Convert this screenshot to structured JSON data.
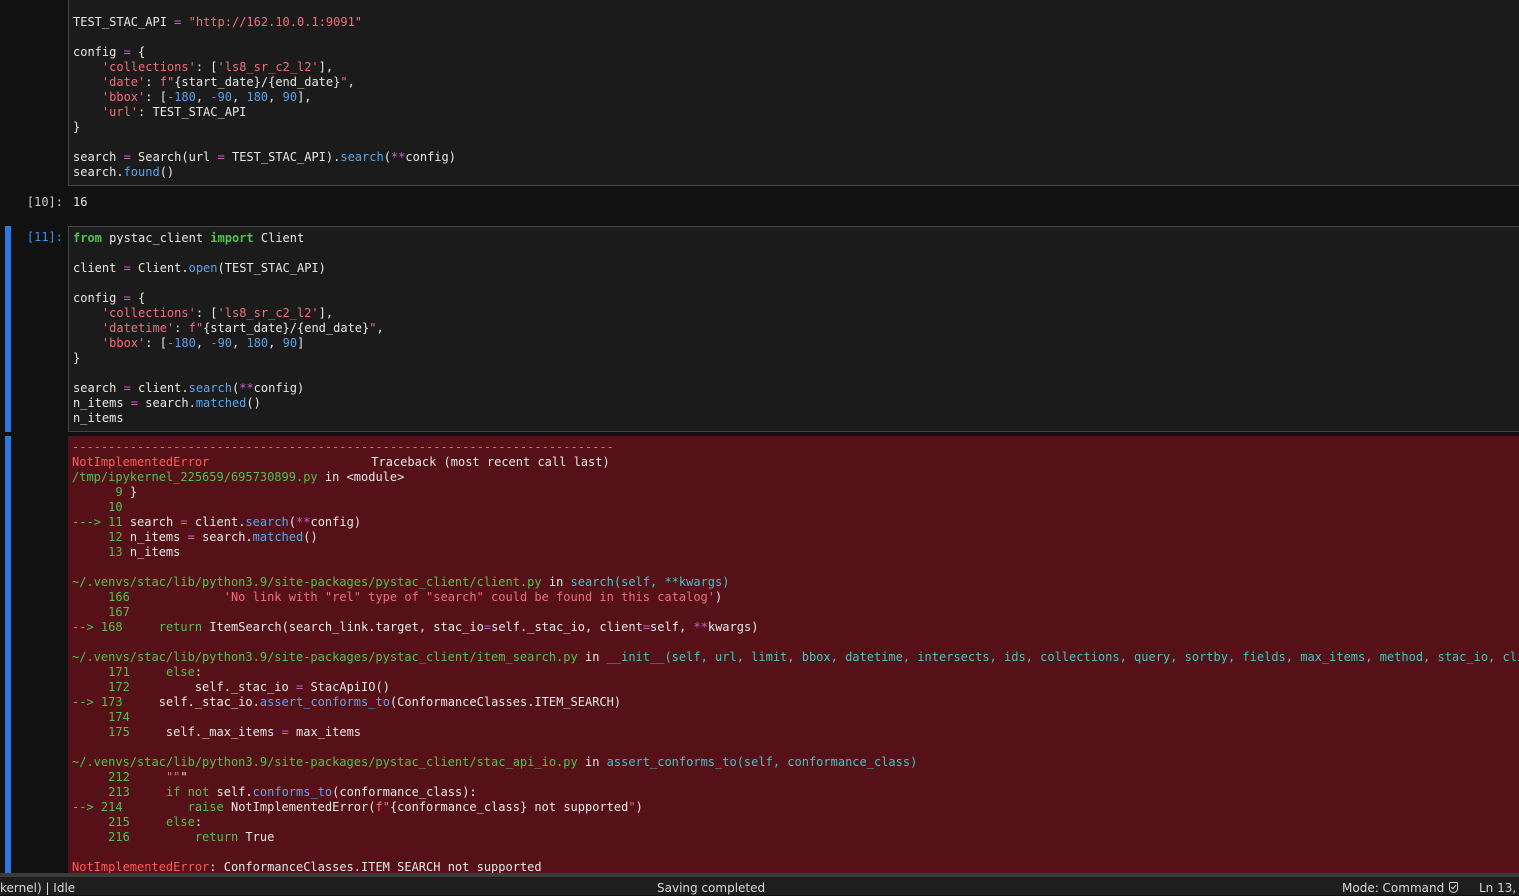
{
  "cells": {
    "cell10": {
      "code": [
        "TEST_STAC_API = \"http://162.10.0.1:9091\"",
        "",
        "config = {",
        "    'collections': ['ls8_sr_c2_l2'],",
        "    'date': f\"{start_date}/{end_date}\",",
        "    'bbox': [-180, -90, 180, 90],",
        "    'url': TEST_STAC_API",
        "}",
        "",
        "search = Search(url = TEST_STAC_API).search(**config)",
        "search.found()"
      ],
      "out_prompt": "[10]:",
      "output": "16"
    },
    "cell11": {
      "in_prompt": "[11]:",
      "code": [
        "from pystac_client import Client",
        "",
        "client = Client.open(TEST_STAC_API)",
        "",
        "config = {",
        "    'collections': ['ls8_sr_c2_l2'],",
        "    'datetime': f\"{start_date}/{end_date}\",",
        "    'bbox': [-180, -90, 180, 90]",
        "}",
        "",
        "search = client.search(**config)",
        "n_items = search.matched()",
        "n_items"
      ],
      "traceback": {
        "separator": "---------------------------------------------------------------------------",
        "error_name": "NotImplementedError",
        "header_right": "Traceback (most recent call last)",
        "frames": [
          {
            "file": "/tmp/ipykernel_225659/695730899.py",
            "in_word": "in",
            "location": "<module>",
            "lines": [
              {
                "arrow": "",
                "num": "9",
                "code": "}"
              },
              {
                "arrow": "",
                "num": "10",
                "code": ""
              },
              {
                "arrow": "--->",
                "num": "11",
                "code": "search = client.search(**config)"
              },
              {
                "arrow": "",
                "num": "12",
                "code": "n_items = search.matched()"
              },
              {
                "arrow": "",
                "num": "13",
                "code": "n_items"
              }
            ]
          },
          {
            "file": "~/.venvs/stac/lib/python3.9/site-packages/pystac_client/client.py",
            "in_word": "in",
            "location": "search(self, **kwargs)",
            "lines": [
              {
                "arrow": "",
                "num": "166",
                "code": "            'No link with \"rel\" type of \"search\" could be found in this catalog')"
              },
              {
                "arrow": "",
                "num": "167",
                "code": ""
              },
              {
                "arrow": "-->",
                "num": "168",
                "code": "    return ItemSearch(search_link.target, stac_io=self._stac_io, client=self, **kwargs)"
              }
            ]
          },
          {
            "file": "~/.venvs/stac/lib/python3.9/site-packages/pystac_client/item_search.py",
            "in_word": "in",
            "location": "__init__(self, url, limit, bbox, datetime, intersects, ids, collections, query, sortby, fields, max_items, method, stac_io, client)",
            "lines": [
              {
                "arrow": "",
                "num": "171",
                "code": "    else:"
              },
              {
                "arrow": "",
                "num": "172",
                "code": "        self._stac_io = StacApiIO()"
              },
              {
                "arrow": "-->",
                "num": "173",
                "code": "    self._stac_io.assert_conforms_to(ConformanceClasses.ITEM_SEARCH)"
              },
              {
                "arrow": "",
                "num": "174",
                "code": ""
              },
              {
                "arrow": "",
                "num": "175",
                "code": "    self._max_items = max_items"
              }
            ]
          },
          {
            "file": "~/.venvs/stac/lib/python3.9/site-packages/pystac_client/stac_api_io.py",
            "in_word": "in",
            "location": "assert_conforms_to(self, conformance_class)",
            "lines": [
              {
                "arrow": "",
                "num": "212",
                "code": "    \"\"\""
              },
              {
                "arrow": "",
                "num": "213",
                "code": "    if not self.conforms_to(conformance_class):"
              },
              {
                "arrow": "-->",
                "num": "214",
                "code": "        raise NotImplementedError(f\"{conformance_class} not supported\")"
              },
              {
                "arrow": "",
                "num": "215",
                "code": "    else:"
              },
              {
                "arrow": "",
                "num": "216",
                "code": "        return True"
              }
            ]
          }
        ],
        "final_error_name": "NotImplementedError",
        "final_message": ": ConformanceClasses.ITEM_SEARCH not supported"
      }
    }
  },
  "statusbar": {
    "kernel_status": "kernel) | Idle",
    "saving": "Saving completed",
    "mode": "Mode: Command",
    "position": "Ln 13, C",
    "shield_icon": "shield-check-icon"
  },
  "colors": {
    "error_background": "#561017",
    "active_cell_bar": "#2f77e0",
    "notebook_background": "#111111"
  }
}
